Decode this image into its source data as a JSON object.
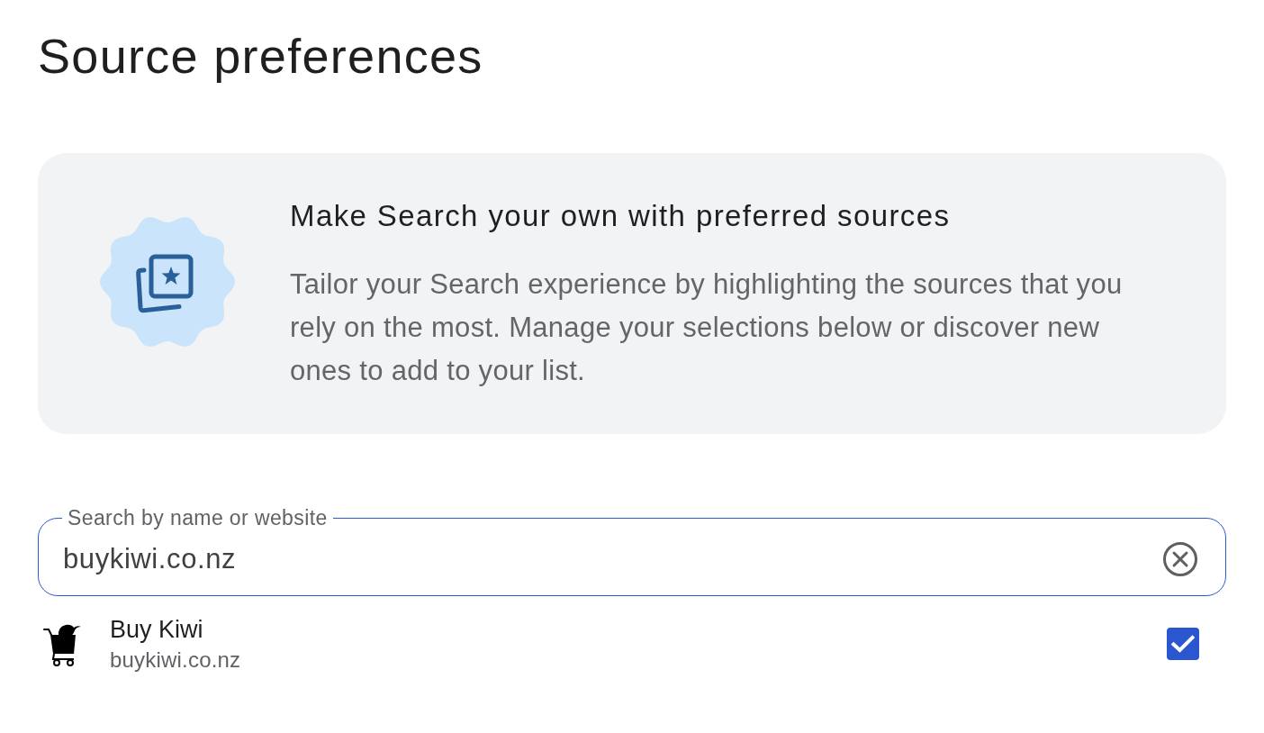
{
  "page": {
    "title": "Source preferences"
  },
  "promo": {
    "heading": "Make Search your own with preferred sources",
    "description": "Tailor your Search experience by highlighting the sources that you rely on the most. Manage your selections below or discover new ones to add to your list."
  },
  "search": {
    "label": "Search by name or website",
    "value": "buykiwi.co.nz"
  },
  "results": [
    {
      "name": "Buy Kiwi",
      "site": "buykiwi.co.nz",
      "checked": true
    }
  ]
}
